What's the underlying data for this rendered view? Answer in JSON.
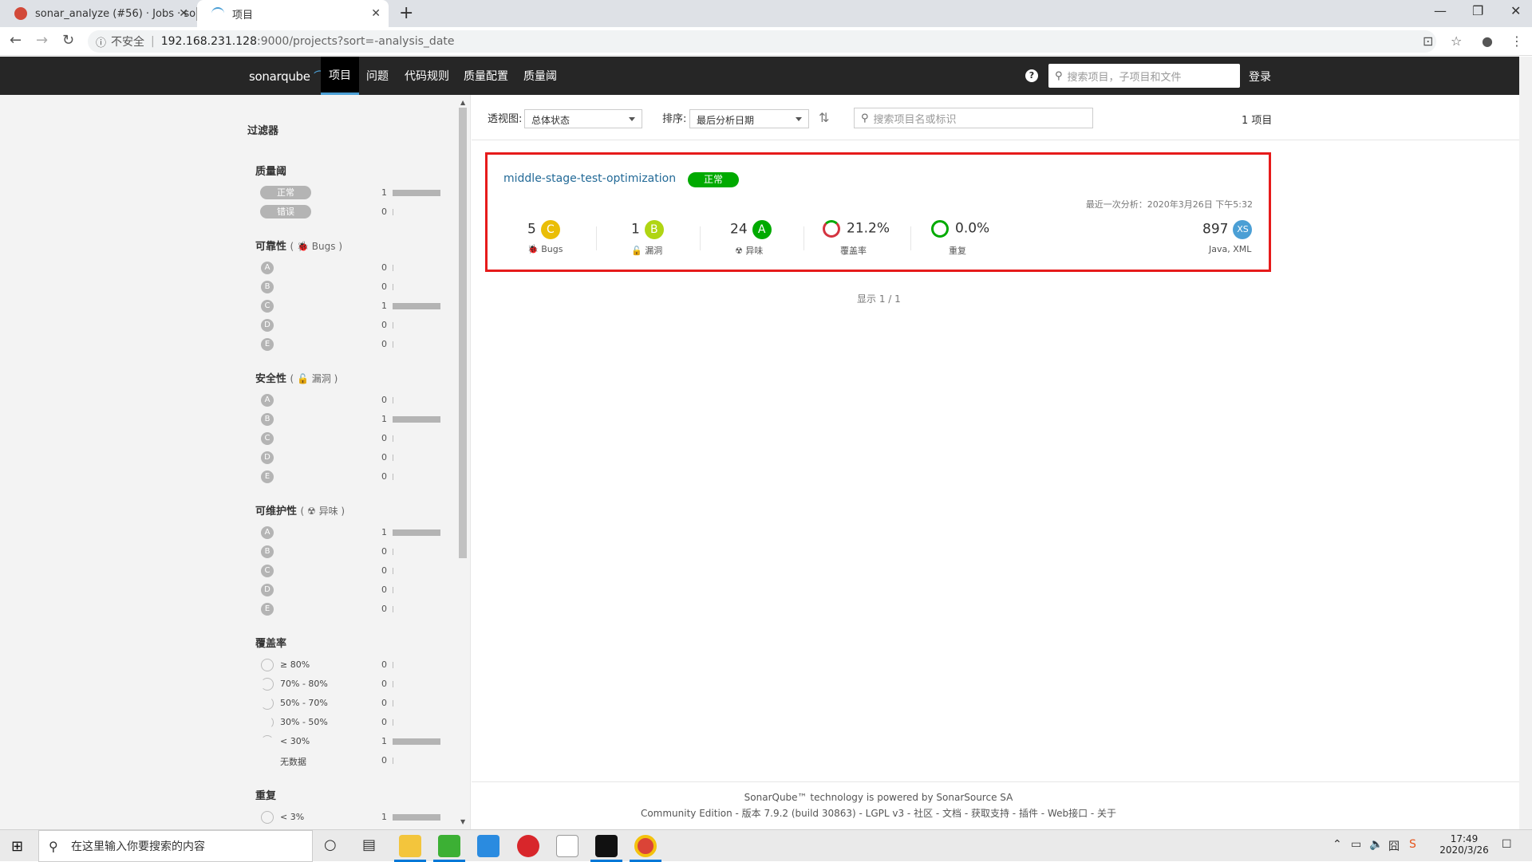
{
  "browser": {
    "tabs": [
      {
        "title": "sonar_analyze (#56) · Jobs · so"
      },
      {
        "title": "项目"
      }
    ],
    "url_warning": "不安全",
    "url_host": "192.168.231.128",
    "url_path": ":9000/projects?sort=-analysis_date"
  },
  "nav": {
    "logo": "sonarqube",
    "menu": [
      "项目",
      "问题",
      "代码规则",
      "质量配置",
      "质量阈"
    ],
    "search_placeholder": "搜索项目，子项目和文件",
    "login": "登录"
  },
  "sidebar": {
    "title": "过滤器",
    "quality_gate": {
      "title": "质量阈",
      "items": [
        {
          "label": "正常",
          "count": "1"
        },
        {
          "label": "错误",
          "count": "0"
        }
      ]
    },
    "reliability": {
      "title": "可靠性",
      "sub": "( 🐞 Bugs )",
      "items": [
        {
          "label": "A",
          "count": "0"
        },
        {
          "label": "B",
          "count": "0"
        },
        {
          "label": "C",
          "count": "1"
        },
        {
          "label": "D",
          "count": "0"
        },
        {
          "label": "E",
          "count": "0"
        }
      ]
    },
    "security": {
      "title": "安全性",
      "sub": "( 🔓 漏洞 )",
      "items": [
        {
          "label": "A",
          "count": "0"
        },
        {
          "label": "B",
          "count": "1"
        },
        {
          "label": "C",
          "count": "0"
        },
        {
          "label": "D",
          "count": "0"
        },
        {
          "label": "E",
          "count": "0"
        }
      ]
    },
    "maintainability": {
      "title": "可维护性",
      "sub": "( ☢ 异味 )",
      "items": [
        {
          "label": "A",
          "count": "1"
        },
        {
          "label": "B",
          "count": "0"
        },
        {
          "label": "C",
          "count": "0"
        },
        {
          "label": "D",
          "count": "0"
        },
        {
          "label": "E",
          "count": "0"
        }
      ]
    },
    "coverage": {
      "title": "覆盖率",
      "items": [
        {
          "label": "≥ 80%",
          "count": "0"
        },
        {
          "label": "70% - 80%",
          "count": "0"
        },
        {
          "label": "50% - 70%",
          "count": "0"
        },
        {
          "label": "30% - 50%",
          "count": "0"
        },
        {
          "label": "< 30%",
          "count": "1"
        },
        {
          "label": "无数据",
          "count": "0"
        }
      ]
    },
    "duplication": {
      "title": "重复",
      "items": [
        {
          "label": "< 3%",
          "count": "1"
        }
      ]
    }
  },
  "toolbar": {
    "perspective_label": "透视图:",
    "perspective_value": "总体状态",
    "sort_label": "排序:",
    "sort_value": "最后分析日期",
    "search_placeholder": "搜索项目名或标识",
    "project_count": "1 项目"
  },
  "project": {
    "name": "middle-stage-test-optimization",
    "gate": "正常",
    "last_analysis": "最近一次分析：2020年3月26日 下午5:32",
    "bugs": {
      "value": "5",
      "rating": "C",
      "label": "Bugs"
    },
    "vulns": {
      "value": "1",
      "rating": "B",
      "label": "漏洞"
    },
    "smells": {
      "value": "24",
      "rating": "A",
      "label": "异味"
    },
    "coverage": {
      "value": "21.2%",
      "label": "覆盖率"
    },
    "duplication": {
      "value": "0.0%",
      "label": "重复"
    },
    "size": {
      "value": "897",
      "rating": "XS",
      "label": "Java, XML"
    }
  },
  "pagination": "显示 1 / 1",
  "footer": {
    "line1": "SonarQube™ technology is powered by SonarSource SA",
    "line2": "Community Edition - 版本 7.9.2 (build 30863) - LGPL v3 - 社区 - 文档 - 获取支持 - 插件 - Web接口 - 关于"
  },
  "taskbar": {
    "search_placeholder": "在这里输入你要搜索的内容",
    "time": "17:49",
    "date": "2020/3/26"
  },
  "colors": {
    "rating_A": "#00aa00",
    "rating_B": "#b0d513",
    "rating_C": "#eabe06",
    "accent": "#4b9fd5",
    "highlight": "#e61b1b"
  }
}
